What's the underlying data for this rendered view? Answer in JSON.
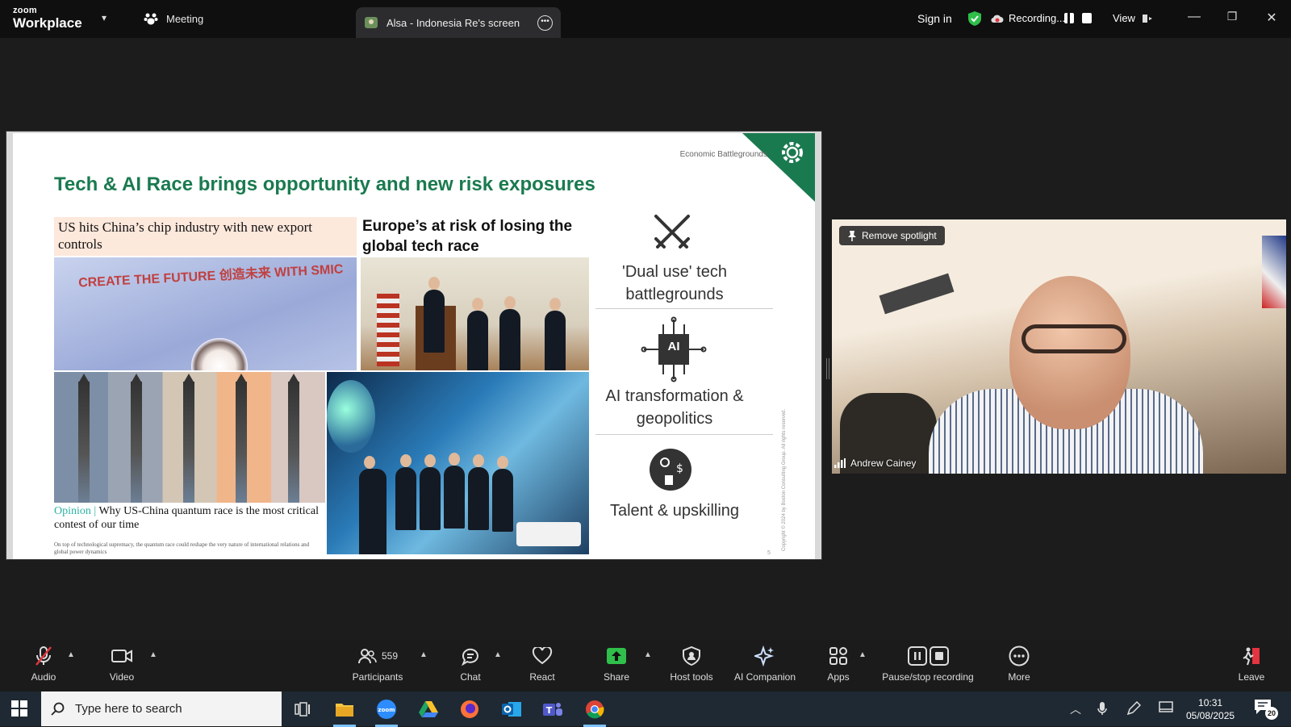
{
  "titlebar": {
    "brand_small": "zoom",
    "brand_big": "Workplace",
    "meeting_tab": "Meeting",
    "share_tab": "Alsa - Indonesia Re's screen",
    "sign_in": "Sign in",
    "recording": "Recording...",
    "view": "View"
  },
  "slide": {
    "title": "Tech & AI Race brings opportunity and new risk exposures",
    "section": "Economic Battlegrounds",
    "news1_headline": "US hits China’s chip industry with new export controls",
    "smic_text": "CREATE THE FUTURE 创造未来 WITH SMIC",
    "news2_headline": "Europe’s at risk of losing the global tech race",
    "opinion_label": "Opinion",
    "opinion_sep": " | ",
    "opinion_title": "Why US-China quantum race is the most critical contest of our time",
    "opinion_sub": "On top of technological supremacy, the quantum race could reshape the very nature of international relations and global power dynamics",
    "pillars": [
      {
        "icon": "crossed-swords-icon",
        "label": "'Dual use' tech battlegrounds"
      },
      {
        "icon": "ai-chip-icon",
        "chip_text": "AI",
        "label": "AI transformation & geopolitics"
      },
      {
        "icon": "talent-head-icon",
        "label": "Talent & upskilling"
      }
    ],
    "copyright": "Copyright © 2024 by Boston Consulting Group. All rights reserved.",
    "page": "5"
  },
  "video": {
    "spotlight_button": "Remove spotlight",
    "participant_name": "Andrew Cainey"
  },
  "toolbar": {
    "audio": "Audio",
    "video": "Video",
    "participants": "Participants",
    "participants_count": "559",
    "chat": "Chat",
    "react": "React",
    "share": "Share",
    "host_tools": "Host tools",
    "ai_companion": "AI Companion",
    "apps": "Apps",
    "pause_stop": "Pause/stop recording",
    "more": "More",
    "leave": "Leave"
  },
  "taskbar": {
    "search_placeholder": "Type here to search",
    "time": "10:31",
    "date": "05/08/2025",
    "notifications": "20"
  },
  "colors": {
    "slide_green": "#1a7a4f",
    "share_green": "#2fbf4a",
    "recording_red": "#e3353f"
  }
}
